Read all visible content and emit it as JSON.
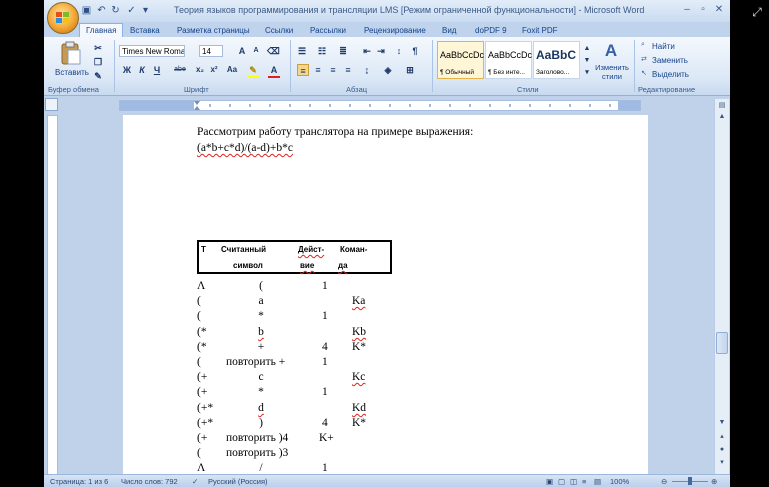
{
  "window": {
    "title": "Теория языков программирования и трансляции LMS [Режим ограниченной функциональности] - Microsoft Word"
  },
  "tabs": [
    "Главная",
    "Вставка",
    "Разметка страницы",
    "Ссылки",
    "Рассылки",
    "Рецензирование",
    "Вид",
    "doPDF 9",
    "Foxit PDF"
  ],
  "ribbon": {
    "clipboard": {
      "paste_label": "Вставить",
      "group_label": "Буфер обмена"
    },
    "font": {
      "name": "Times New Roman",
      "size": "14",
      "group_label": "Шрифт",
      "bold": "Ж",
      "italic": "К",
      "underline": "Ч",
      "strike": "abe",
      "sub": "x₂",
      "sup": "x²",
      "case": "Aa"
    },
    "paragraph": {
      "group_label": "Абзац"
    },
    "styles": {
      "group_label": "Стили",
      "items": [
        {
          "sample": "AaBbCcDc",
          "name": "¶ Обычный"
        },
        {
          "sample": "AaBbCcDc",
          "name": "¶ Без инте..."
        },
        {
          "sample": "AaBbC",
          "name": "Заголово..."
        }
      ],
      "change_label": "Изменить стили"
    },
    "editing": {
      "find": "Найти",
      "replace": "Заменить",
      "select": "Выделить",
      "group_label": "Редактирование"
    }
  },
  "document": {
    "line1": "Рассмотрим работу транслятора на примере выражения:",
    "expression": "(a*b+c*d)/(a-d)+b*c",
    "table_headers": {
      "col1": "T",
      "col2a": "Считанный",
      "col2b": "символ",
      "col3a": "Дейст-",
      "col3b": "вие",
      "col4a": "Коман-",
      "col4b": "да"
    },
    "rows": [
      {
        "stack": "Λ",
        "symbol": "(",
        "action": "1",
        "command": ""
      },
      {
        "stack": "(",
        "symbol": "a",
        "action": "",
        "command": "Ka"
      },
      {
        "stack": "(",
        "symbol": "*",
        "action": "1",
        "command": ""
      },
      {
        "stack": "(*",
        "symbol": "b",
        "action": "",
        "command": "Kb"
      },
      {
        "stack": "(*",
        "symbol": "+",
        "action": "4",
        "command": "K*"
      },
      {
        "stack": "(",
        "symbol": "повторить +",
        "action": "1",
        "command": ""
      },
      {
        "stack": "(+",
        "symbol": "c",
        "action": "",
        "command": "Kc"
      },
      {
        "stack": "(+",
        "symbol": "*",
        "action": "1",
        "command": ""
      },
      {
        "stack": "(+*",
        "symbol": "d",
        "action": "",
        "command": "Kd"
      },
      {
        "stack": "(+*",
        "symbol": ")",
        "action": "4",
        "command": "K*"
      },
      {
        "stack": "(+",
        "symbol": "повторить )4",
        "action": "",
        "command": "K+"
      },
      {
        "stack": "(",
        "symbol": "повторить )3",
        "action": "",
        "command": ""
      },
      {
        "stack": "Λ",
        "symbol": "/",
        "action": "1",
        "command": ""
      }
    ]
  },
  "statusbar": {
    "page": "Страница: 1 из 6",
    "words": "Число слов: 792",
    "language": "Русский (Россия)",
    "zoom": "100%"
  },
  "icons": [
    "office-button-icon",
    "save-icon",
    "undo-icon",
    "redo-icon",
    "fullscreen-icon"
  ]
}
